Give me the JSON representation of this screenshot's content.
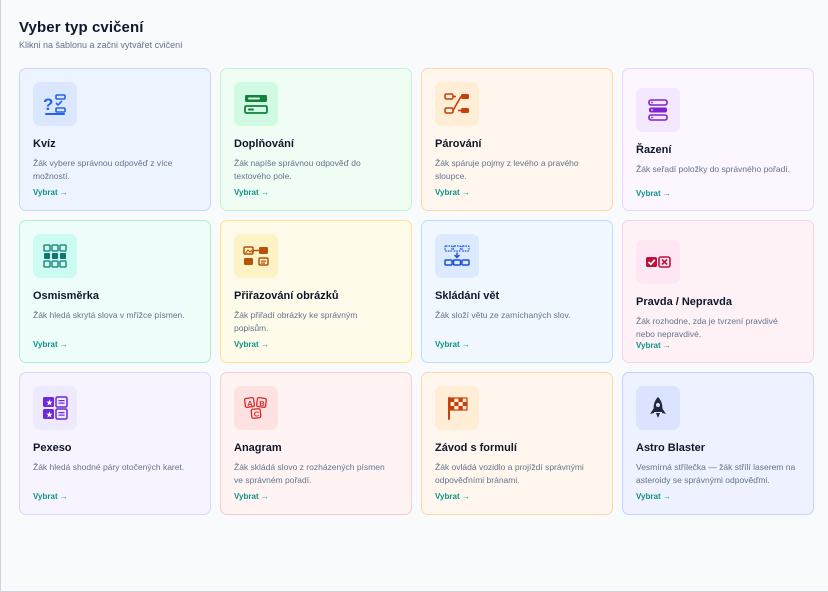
{
  "header": {
    "title": "Vyber typ cvičení",
    "subtitle": "Klikni na šablonu a začni vytvářet cvičení"
  },
  "cards": [
    {
      "title": "Kvíz",
      "desc": "Žák vybere správnou odpověď z více možností.",
      "link": "Vybrat →",
      "icon": "quiz-icon",
      "bg": "#eef4ff",
      "border": "#c7d7fe",
      "tile": "#dbe7ff",
      "accent": "#2563eb"
    },
    {
      "title": "Doplňování",
      "desc": "Žák napíše správnou odpověď do textového pole.",
      "link": "Vybrat →",
      "icon": "fill-in-icon",
      "bg": "#effdf4",
      "border": "#bbf7d0",
      "tile": "#d1fae5",
      "accent": "#15803d"
    },
    {
      "title": "Párování",
      "desc": "Žák spáruje pojmy z levého a pravého sloupce.",
      "link": "Vybrat →",
      "icon": "matching-icon",
      "bg": "#fff6ed",
      "border": "#fed7aa",
      "tile": "#ffedd5",
      "accent": "#c2410c"
    },
    {
      "title": "Řazení",
      "desc": "Žák seřadí položky do správného pořadí.",
      "link": "Vybrat →",
      "icon": "ordering-icon",
      "bg": "#fbf6ff",
      "border": "#e9d5ff",
      "tile": "#f3e8ff",
      "accent": "#7e22ce"
    },
    {
      "title": "Osmisměrka",
      "desc": "Žák hledá skrytá slova v mřížce písmen.",
      "link": "Vybrat →",
      "icon": "word-search-icon",
      "bg": "#effdfa",
      "border": "#a7f3d0",
      "tile": "#ccfbf1",
      "accent": "#0f766e"
    },
    {
      "title": "Přiřazování obrázků",
      "desc": "Žák přiřadí obrázky ke správným popisům.",
      "link": "Vybrat →",
      "icon": "image-matching-icon",
      "bg": "#fffbeb",
      "border": "#fde68a",
      "tile": "#fef3c7",
      "accent": "#b45309"
    },
    {
      "title": "Skládání vět",
      "desc": "Žák složí větu ze zamíchaných slov.",
      "link": "Vybrat →",
      "icon": "sentence-builder-icon",
      "bg": "#f0f7ff",
      "border": "#bfdbfe",
      "tile": "#dbeafe",
      "accent": "#1d4ed8"
    },
    {
      "title": "Pravda / Nepravda",
      "desc": "Žák rozhodne, zda je tvrzení pravdivé nebo nepravdivé.",
      "link": "Vybrat →",
      "icon": "true-false-icon",
      "bg": "#fff2f7",
      "border": "#fbcfe8",
      "tile": "#fce7f3",
      "accent": "#be123c"
    },
    {
      "title": "Pexeso",
      "desc": "Žák hledá shodné páry otočených karet.",
      "link": "Vybrat →",
      "icon": "memory-cards-icon",
      "bg": "#f7f4ff",
      "border": "#ddd6fe",
      "tile": "#ede9fe",
      "accent": "#6d28d9"
    },
    {
      "title": "Anagram",
      "desc": "Žák skládá slovo z rozházených písmen ve správném pořadí.",
      "link": "Vybrat →",
      "icon": "anagram-icon",
      "bg": "#fff3f3",
      "border": "#fecaca",
      "tile": "#fee2e2",
      "accent": "#dc2626"
    },
    {
      "title": "Závod s formulí",
      "desc": "Žák ovládá vozidlo a projíždí správnými odpověďními bránami.",
      "link": "Vybrat →",
      "icon": "checkered-flag-icon",
      "bg": "#fff6ed",
      "border": "#fed7aa",
      "tile": "#ffedd5",
      "accent": "#c2410c"
    },
    {
      "title": "Astro Blaster",
      "desc": "Vesmírná střílečka — žák střílí laserem na asteroidy se správnými odpověďmi.",
      "link": "Vybrat →",
      "icon": "rocket-icon",
      "bg": "#eef1ff",
      "border": "#c7d2fe",
      "tile": "#dbe3ff",
      "accent": "#1e293b"
    }
  ]
}
